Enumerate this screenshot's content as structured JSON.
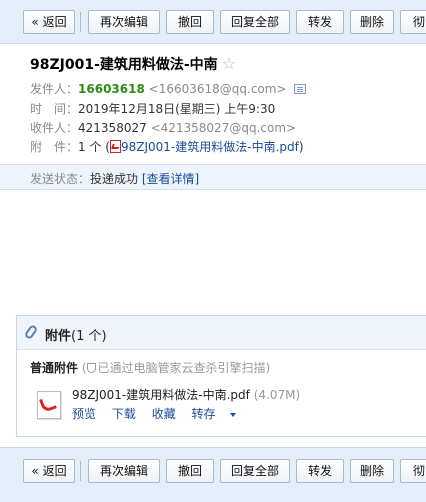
{
  "toolbar": {
    "back": "« 返回",
    "reedit": "再次编辑",
    "recall": "撤回",
    "reply_all": "回复全部",
    "forward": "转发",
    "delete": "删除",
    "more": "彻"
  },
  "mail": {
    "subject": "98ZJ001-建筑用料做法-中南",
    "star": "☆",
    "from_label": "发件人：",
    "from_name": "16603618",
    "from_addr": "<16603618@qq.com>",
    "time_label": "时　间：",
    "time_value": "2019年12月18日(星期三) 上午9:30",
    "to_label": "收件人：",
    "to_name": "421358027",
    "to_addr": "<421358027@qq.com>",
    "att_label": "附　件：",
    "att_count": "1 个 (",
    "att_file": "98ZJ001-建筑用料做法-中南.pdf",
    "att_close": ")"
  },
  "status": {
    "label": "发送状态：",
    "value": "投递成功",
    "detail_link": "[查看详情]"
  },
  "attachments": {
    "title": "附件",
    "count": "(1 个)",
    "normal_label": "普通附件",
    "scan_note_open": "(",
    "scan_note": "已通过电脑管家云查杀引擎扫描",
    "scan_note_close": ")",
    "file_name": "98ZJ001-建筑用料做法-中南.pdf",
    "file_size": "(4.07M)",
    "preview": "预览",
    "download": "下载",
    "collect": "收藏",
    "save_to": "转存"
  },
  "colors": {
    "toolbar_bg": "#e4eef9",
    "link": "#1a4d9c",
    "sender_green": "#2e8b16",
    "pdf_red": "#cc2222"
  }
}
